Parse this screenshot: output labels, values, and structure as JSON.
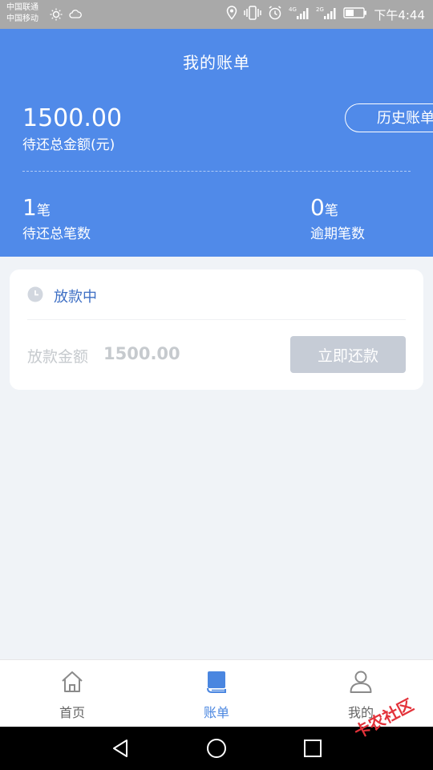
{
  "status_bar": {
    "carrier_1": "中国联通",
    "carrier_2": "中国移动",
    "net_4g": "4G",
    "net_2g": "2G",
    "time": "下午4:44"
  },
  "header": {
    "title": "我的账单",
    "total_amount": "1500.00",
    "total_label": "待还总金额(元)",
    "history_button": "历史账单",
    "pending_count": "1",
    "pending_unit": "笔",
    "pending_label": "待还总笔数",
    "overdue_count": "0",
    "overdue_unit": "笔",
    "overdue_label": "逾期笔数"
  },
  "bill_card": {
    "status": "放款中",
    "amount_label": "放款金额",
    "amount_value": "1500.00",
    "repay_button": "立即还款"
  },
  "tabs": [
    {
      "label": "首页",
      "icon": "home-icon"
    },
    {
      "label": "账单",
      "icon": "book-icon",
      "active": true
    },
    {
      "label": "我的",
      "icon": "user-icon"
    }
  ],
  "watermark": {
    "text": "卡农社区"
  },
  "colors": {
    "header_bg": "#508ae9",
    "accent": "#4a86e0",
    "disabled_button": "#c6ccd6",
    "page_bg": "#f0f3f7"
  }
}
